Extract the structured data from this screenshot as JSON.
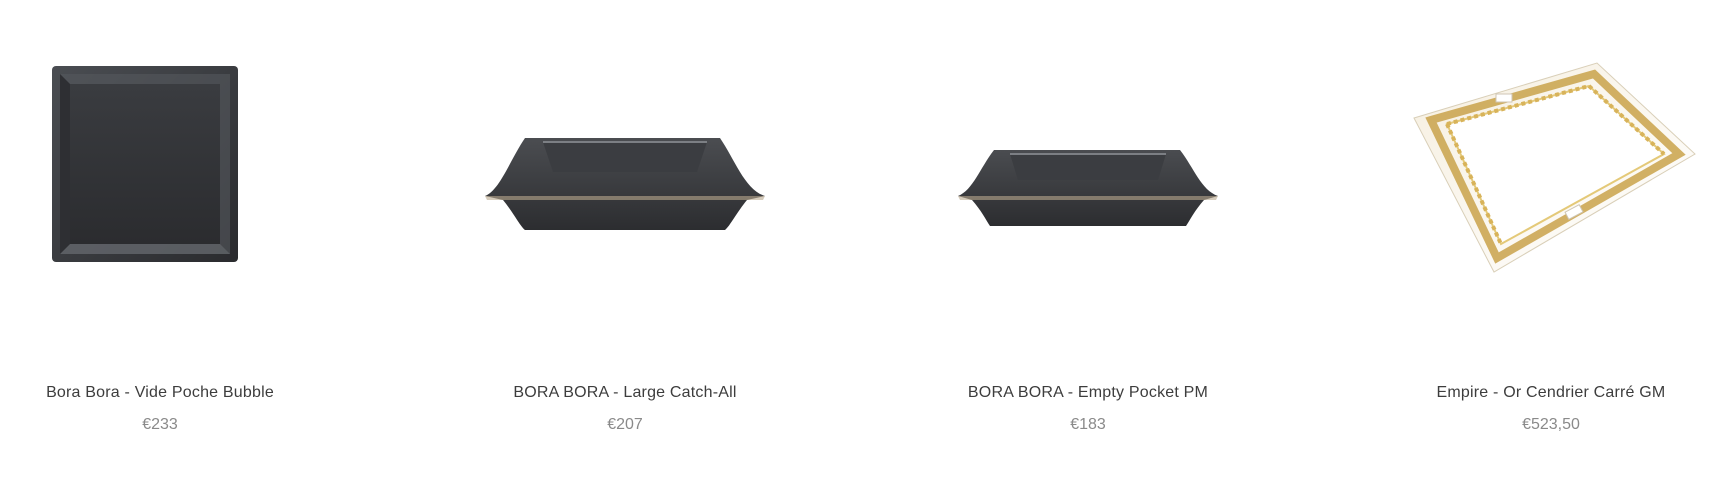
{
  "products": [
    {
      "name": "Bora Bora - Vide Poche Bubble",
      "price": "€233",
      "image": "square-dark-tray-image"
    },
    {
      "name": "BORA BORA - Large Catch-All",
      "price": "€207",
      "image": "large-dark-tray-image"
    },
    {
      "name": "BORA BORA - Empty Pocket PM",
      "price": "€183",
      "image": "small-dark-tray-image"
    },
    {
      "name": "Empire - Or Cendrier Carré GM",
      "price": "€523,50",
      "image": "gold-ashtray-image"
    }
  ],
  "colors": {
    "title": "#3d3d3d",
    "price": "#8a8a8a",
    "tray_dark": "#3a3b3e",
    "gold": "#c9a24a"
  }
}
